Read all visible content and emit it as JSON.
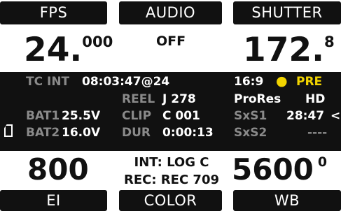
{
  "top_tabs": {
    "fps": "FPS",
    "audio": "AUDIO",
    "shutter": "SHUTTER"
  },
  "top_values": {
    "fps_main": "24.",
    "fps_decimal": "000",
    "audio_value": "OFF",
    "shutter_main": "172.",
    "shutter_decimal": "8"
  },
  "info_panel": {
    "tc_label": "TC INT",
    "tc_value": "08:03:47@24",
    "aspect": "16:9",
    "status_dot": "●",
    "pre_label": "PRE",
    "reel_label": "REEL",
    "reel_value": "J 278",
    "codec": "ProRes",
    "quality": "HD",
    "bat1_label": "BAT1",
    "bat1_value": "25.5V",
    "clip_label": "CLIP",
    "clip_value": "C 001",
    "sxs1_label": "SxS1",
    "sxs1_value": "28:47",
    "sxs1_marker": "<",
    "bat2_label": "BAT2",
    "bat2_value": "16.0V",
    "dur_label": "DUR",
    "dur_value": "0:00:13",
    "sxs2_label": "SxS2",
    "sxs2_value": "----"
  },
  "bottom_values": {
    "ei_value": "800",
    "look_int": "INT: LOG C",
    "look_rec": "REC: REC 709",
    "wb_main": "5600",
    "wb_tint": "0"
  },
  "bottom_tabs": {
    "ei": "EI",
    "color": "COLOR",
    "wb": "WB"
  },
  "colors": {
    "background": "#ffffff",
    "panel": "#111111",
    "highlight": "#f2d400",
    "dim_text": "#8a8a8a"
  }
}
